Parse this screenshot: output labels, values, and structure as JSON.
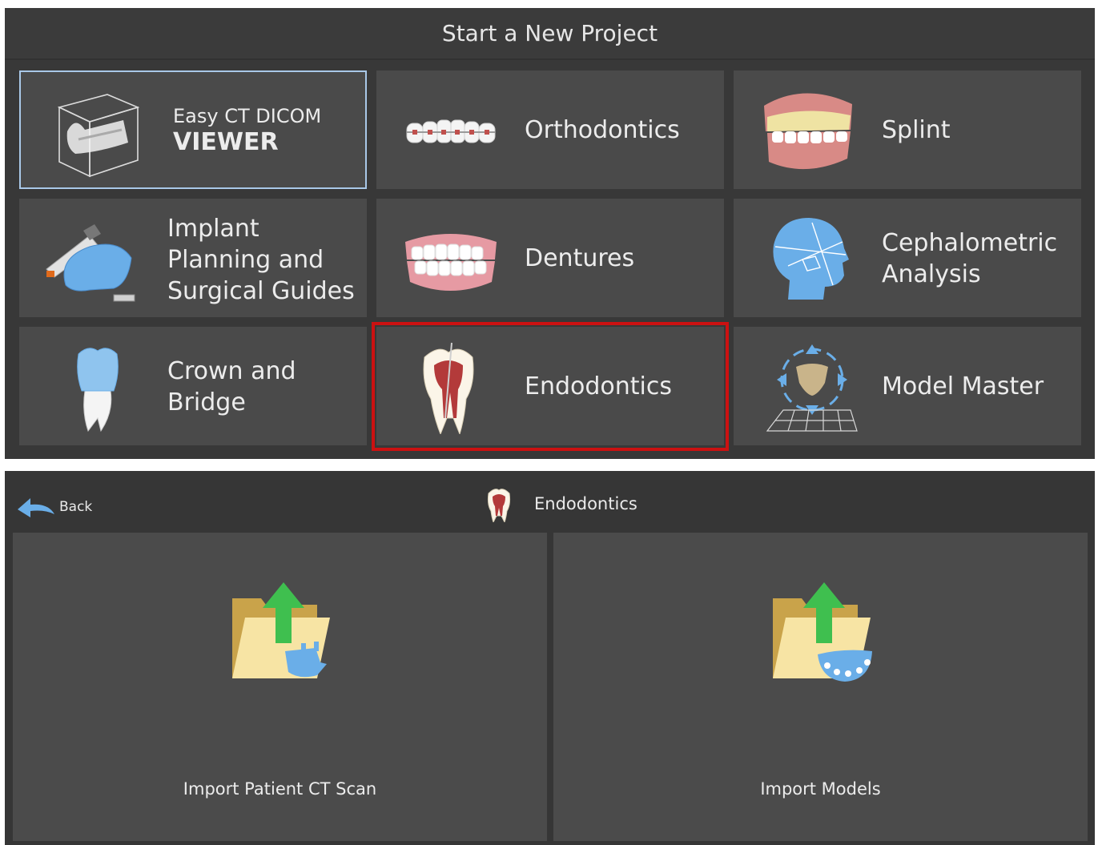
{
  "top": {
    "title": "Start a New Project",
    "tiles": [
      {
        "line1": "Easy CT DICOM",
        "line2": "VIEWER"
      },
      {
        "label": "Orthodontics"
      },
      {
        "label": "Splint"
      },
      {
        "label": "Implant\nPlanning and\nSurgical Guides"
      },
      {
        "label": "Dentures"
      },
      {
        "label": "Cephalometric\nAnalysis"
      },
      {
        "label": "Crown and\nBridge"
      },
      {
        "label": "Endodontics"
      },
      {
        "label": "Model Master"
      }
    ]
  },
  "bottom": {
    "back_label": "Back",
    "title": "Endodontics",
    "cards": [
      {
        "label": "Import Patient CT Scan"
      },
      {
        "label": "Import Models"
      }
    ]
  },
  "colors": {
    "highlight": "#cc1111",
    "selected_border": "#a9c8e8",
    "accent_blue": "#6aaee8",
    "arrow_green": "#3fbf4f"
  }
}
